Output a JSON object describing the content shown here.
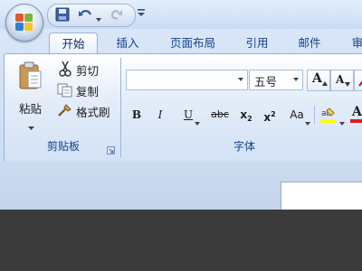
{
  "tabs": [
    "开始",
    "插入",
    "页面布局",
    "引用",
    "邮件",
    "审"
  ],
  "clipboard": {
    "paste": "粘贴",
    "cut": "剪切",
    "copy": "复制",
    "format_painter": "格式刷",
    "group_label": "剪贴板"
  },
  "font": {
    "font_name": "",
    "font_size": "五号",
    "grow": "A",
    "shrink": "A",
    "group_label": "字体",
    "bold": "B",
    "italic": "I",
    "underline": "U",
    "strikethrough": "abc",
    "subscript": "x",
    "superscript": "x",
    "sub_digit": "2",
    "super_digit": "2",
    "change_case": "Aa",
    "highlight_sample": "ab",
    "font_color": "A"
  },
  "colors": {
    "accent_text": "#15428b",
    "highlight": "#ffff00",
    "font_color_bar": "#e01a1a"
  }
}
